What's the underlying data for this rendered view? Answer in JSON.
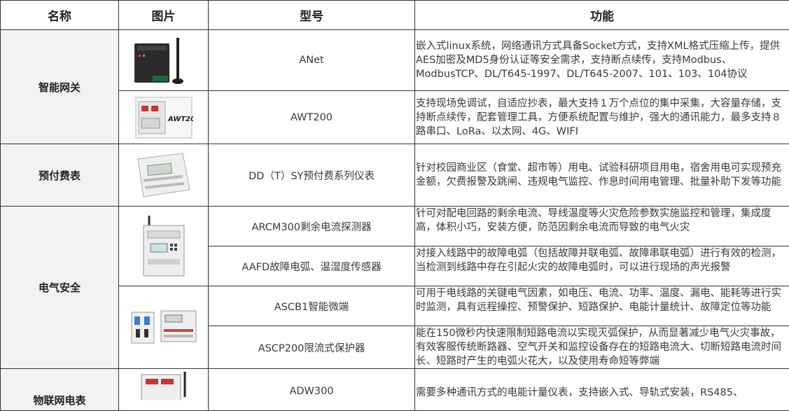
{
  "headers": {
    "name": "名称",
    "image": "图片",
    "model": "型号",
    "function": "功能"
  },
  "categories": {
    "gateway": "智能网关",
    "prepaid": "预付费表",
    "electrical_safety": "电气安全",
    "iot_meter": "物联网电表"
  },
  "rows": [
    {
      "model": "ANet",
      "function": "嵌入式linux系统，网络通讯方式具备Socket方式，支持XML格式压缩上传，提供AES加密及MD5身份认证等安全需求，支持断点续传，支持Modbus、ModbusTCP、DL/T645-1997、DL/T645-2007、101、103、104协议"
    },
    {
      "model": "AWT200",
      "image_label": "AWT200",
      "function": "支持现场免调试，自适应抄表，最大支持１万个点位的集中采集，大容量存储，支持断点续传，配套管理工具，方便系统配置与维护，强大的通讯能力，最多支持８路串口、LoRa、以太网、4G、WIFI"
    },
    {
      "model": "DD（T）SY预付费系列仪表",
      "function": "针对校园商业区（食堂、超市等）用电、试验科研项目用电，宿舍用电可实现预充金额，欠费报警及跳闸、违规电气监控、作息时间用电管理、批量补助下发等功能"
    },
    {
      "model": "ARCM300剩余电流探测器",
      "function": "针可对配电回路的剩余电流、导线温度等火灾危险参数实施监控和管理，集成度高，体积小巧，安装方便，防范因剩余电流而导致的电气火灾"
    },
    {
      "model": "AAFD故障电弧、温湿度传感器",
      "function": "对接入线路中的故障电弧（包括故障并联电弧、故障串联电弧）进行有效的检测，当检测到线路中存在引起火灾的故障电弧时，可以进行现场的声光报警"
    },
    {
      "model": "ASCB1智能微端",
      "function": "可用于电线路的关键电气因素，如电压、电流、功率、温度、漏电、能耗等进行实时监测，具有远程操控、预警保护、短路保护、电能计量统计、故障定位等功能"
    },
    {
      "model": "ASCP200限流式保护器",
      "function": "能在150微秒内快速限制短路电流以实现灭弧保护，从而显著减少电气火灾事故，有效客服传统断路器、空气开关和监控设备存在的短路电流大、切断短路电流时间长、短路时产生的电弧火花大，以及使用寿命短等弊端"
    },
    {
      "model": "ADW300",
      "function": "需要多种通讯方式的电能计量仪表，支持嵌入式、导轨式安装，RS485、"
    }
  ],
  "colors": {
    "border": "#333333",
    "category_bg": "#f2f2f2",
    "text": "#3a3a3a"
  }
}
